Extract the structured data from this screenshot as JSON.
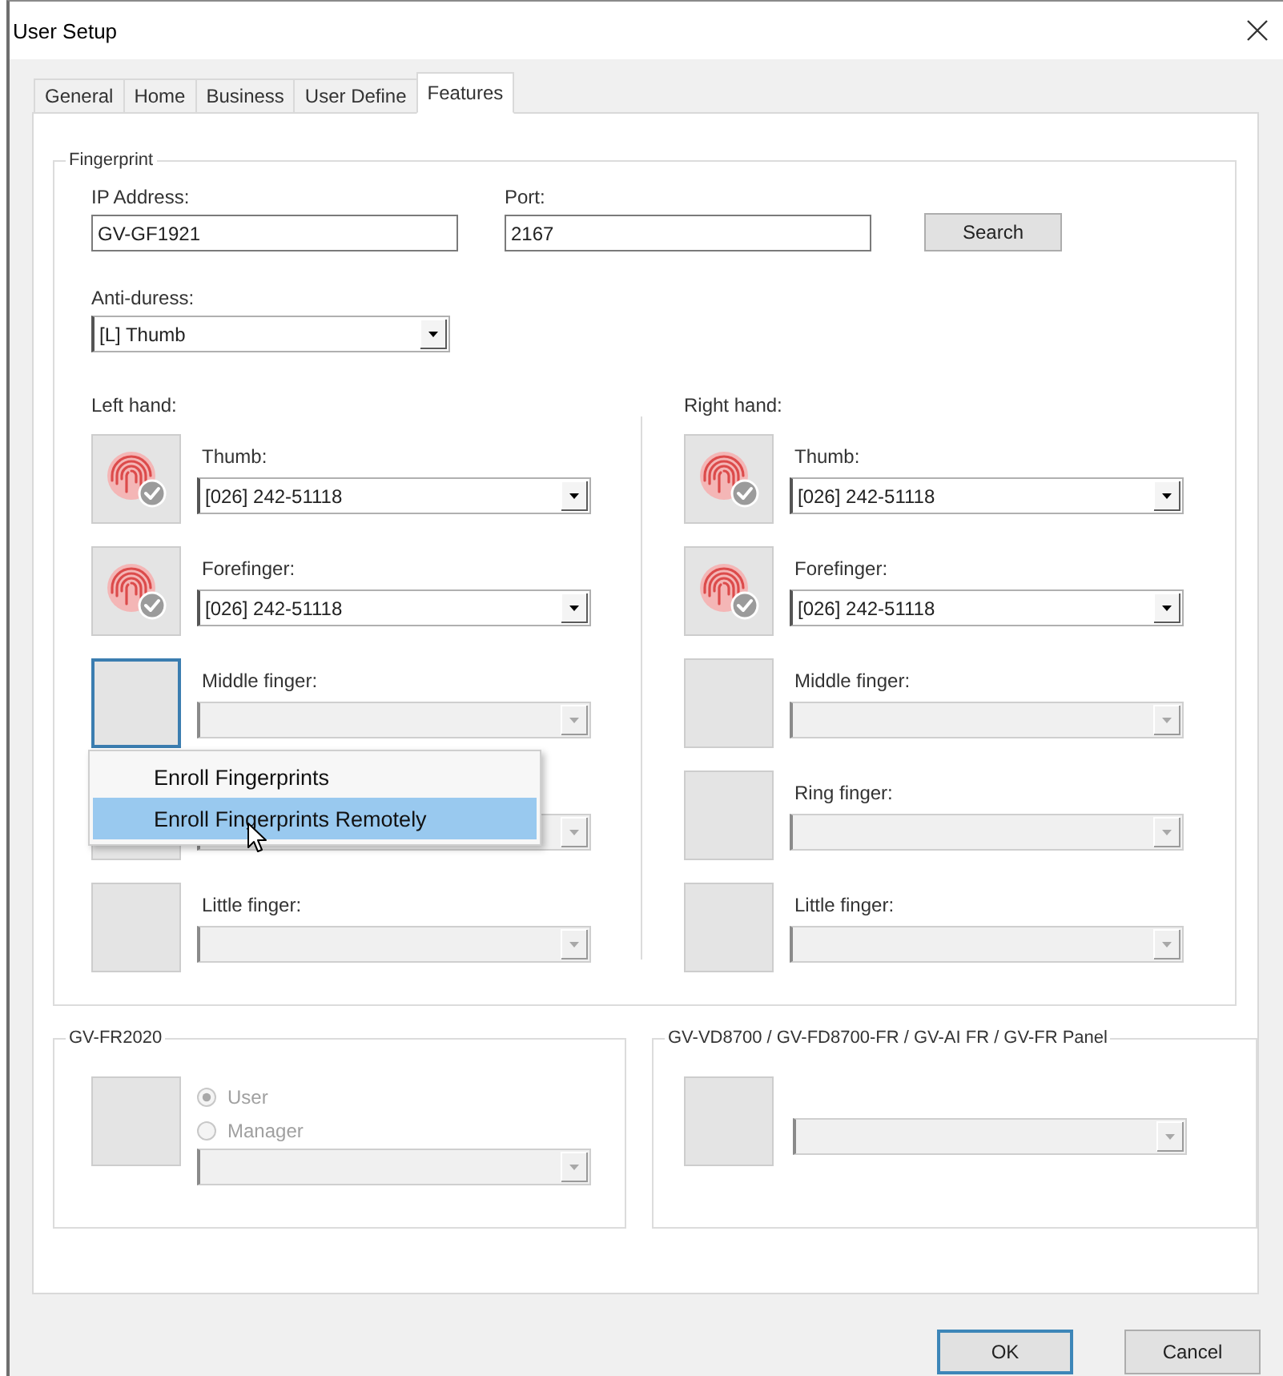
{
  "window": {
    "title": "User Setup"
  },
  "tabs": [
    {
      "label": "General",
      "selected": false
    },
    {
      "label": "Home",
      "selected": false
    },
    {
      "label": "Business",
      "selected": false
    },
    {
      "label": "User Define",
      "selected": false
    },
    {
      "label": "Features",
      "selected": true
    }
  ],
  "fingerprint": {
    "title": "Fingerprint",
    "ip_address": {
      "label": "IP Address:",
      "value": "GV-GF1921"
    },
    "port": {
      "label": "Port:",
      "value": "2167"
    },
    "search_button": "Search",
    "anti_duress": {
      "label": "Anti-duress:",
      "value": "[L] Thumb"
    },
    "hands": [
      {
        "label": "Left hand:",
        "fingers": [
          {
            "label": "Thumb:",
            "value": "[026] 242-51118",
            "enrolled": true,
            "focused": false,
            "disabled": false
          },
          {
            "label": "Forefinger:",
            "value": "[026] 242-51118",
            "enrolled": true,
            "focused": false,
            "disabled": false
          },
          {
            "label": "Middle finger:",
            "enrolled": false,
            "focused": true,
            "disabled": true,
            "context_menu": {
              "items": [
                {
                  "label": "Enroll Fingerprints",
                  "selected": false
                },
                {
                  "label": "Enroll Fingerprints Remotely",
                  "selected": true
                }
              ]
            }
          },
          {
            "enrolled": false,
            "focused": false,
            "disabled": true
          },
          {
            "label": "Little finger:",
            "enrolled": false,
            "focused": false,
            "disabled": true
          }
        ]
      },
      {
        "label": "Right hand:",
        "fingers": [
          {
            "label": "Thumb:",
            "value": "[026] 242-51118",
            "enrolled": true,
            "focused": false,
            "disabled": false
          },
          {
            "label": "Forefinger:",
            "value": "[026] 242-51118",
            "enrolled": true,
            "focused": false,
            "disabled": false
          },
          {
            "label": "Middle finger:",
            "enrolled": false,
            "focused": false,
            "disabled": true
          },
          {
            "label": "Ring finger:",
            "enrolled": false,
            "focused": false,
            "disabled": true
          },
          {
            "label": "Little finger:",
            "enrolled": false,
            "focused": false,
            "disabled": true
          }
        ]
      }
    ]
  },
  "gv_fr2020": {
    "title": "GV-FR2020",
    "radios": [
      {
        "label": "User",
        "selected": true,
        "disabled": true
      },
      {
        "label": "Manager",
        "selected": false,
        "disabled": true
      }
    ],
    "dropdown": {
      "disabled": true
    }
  },
  "gv_vd8700": {
    "title": "GV-VD8700 / GV-FD8700-FR / GV-AI FR / GV-FR Panel",
    "dropdown": {
      "disabled": true
    }
  },
  "buttons": [
    {
      "label": "OK",
      "focused": true
    },
    {
      "label": "Cancel",
      "focused": false
    }
  ]
}
